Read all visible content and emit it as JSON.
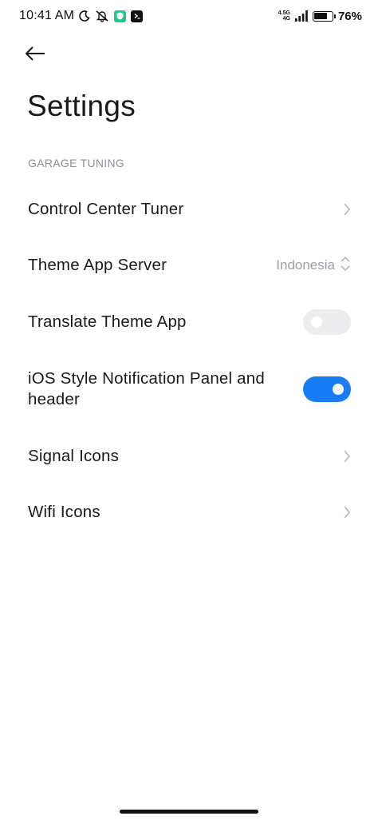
{
  "status_bar": {
    "time": "10:41 AM",
    "net_top": "4.5G",
    "net_bottom": "4G",
    "battery_percent": "76%",
    "battery_level": 0.76,
    "icons": [
      "moon-icon",
      "bell-off-icon",
      "shield-app-icon",
      "terminal-app-icon",
      "signal-icon",
      "battery-icon"
    ]
  },
  "header": {
    "back_icon": "arrow-left-icon",
    "title": "Settings"
  },
  "section": {
    "title": "GARAGE TUNING"
  },
  "items": [
    {
      "label": "Control Center Tuner",
      "type": "link"
    },
    {
      "label": "Theme App Server",
      "type": "select",
      "value": "Indonesia"
    },
    {
      "label": "Translate Theme App",
      "type": "toggle",
      "checked": false
    },
    {
      "label": "iOS Style Notification Panel and header",
      "type": "toggle",
      "checked": true
    },
    {
      "label": "Signal Icons",
      "type": "link"
    },
    {
      "label": "Wifi Icons",
      "type": "link"
    }
  ],
  "colors": {
    "accent": "#1a7cf5",
    "toggle_off": "#ededef",
    "secondary_text": "#8a8f99"
  }
}
